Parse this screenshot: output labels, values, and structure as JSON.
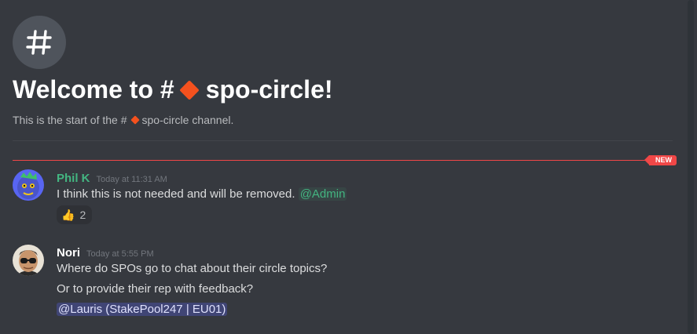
{
  "channel": {
    "name": "spo-circle",
    "welcome_prefix": "Welcome to #",
    "welcome_suffix": "!",
    "intro_prefix": "This is the start of the #",
    "intro_suffix": "channel.",
    "channel_icon": "hash-icon",
    "emoji_icon": "orange-diamond-icon"
  },
  "new_marker": {
    "label": "NEW",
    "color": "#f04747"
  },
  "messages": [
    {
      "author": "Phil K",
      "author_color": "#43b581",
      "timestamp": "Today at 11:31 AM",
      "text": "I think this is not needed and will be removed.",
      "mention": "@Admin",
      "reaction": {
        "emoji": "👍",
        "count": "2"
      }
    },
    {
      "author": "Nori",
      "author_color": "#ffffff",
      "timestamp": "Today at 5:55 PM",
      "lines": [
        "Where do SPOs go to chat about their circle topics?",
        "Or to provide their rep with feedback?"
      ],
      "mention": "@Lauris (StakePool247 | EU01)"
    }
  ]
}
